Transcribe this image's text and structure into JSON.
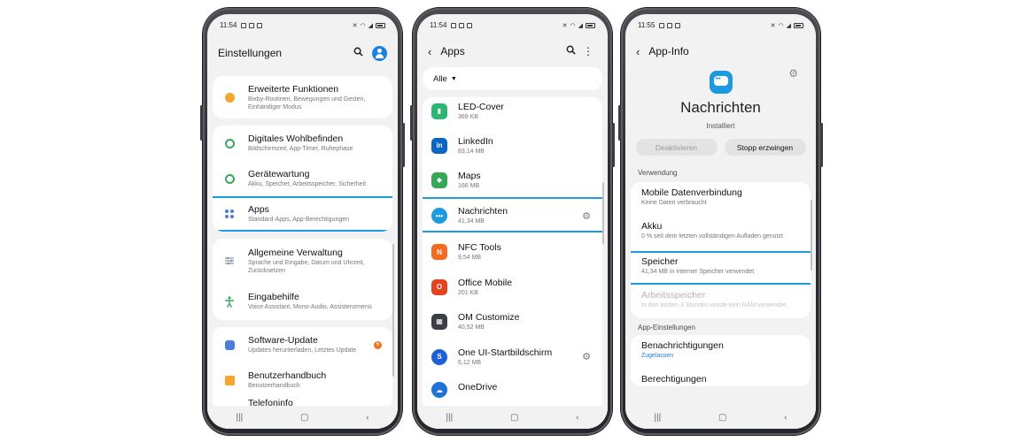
{
  "colors": {
    "accent": "#1e9be0",
    "screen_bg": "#f2f2f2",
    "card_bg": "#ffffff",
    "link": "#1c7fe0",
    "badge": "#f0701e"
  },
  "phone1": {
    "status": {
      "time": "11:54"
    },
    "title": "Einstellungen",
    "icons": {
      "search": "search-icon",
      "account": "avatar-icon"
    },
    "items": [
      {
        "label": "Erweiterte Funktionen",
        "sub": "Bixby-Routinen, Bewegungen und Gesten, Einhändiger Modus",
        "icon_color": "#f4a52a"
      },
      {
        "label": "Digitales Wohlbefinden",
        "sub": "Bildschirmzeit, App-Timer, Ruhephase",
        "icon_color": "#3aa85c"
      },
      {
        "label": "Gerätewartung",
        "sub": "Akku, Speicher, Arbeitsspeicher, Sicherheit",
        "icon_color": "#3aa85c"
      },
      {
        "label": "Apps",
        "sub": "Standard-Apps, App-Berechtigungen",
        "icon_color": "#4a7fd6"
      },
      {
        "label": "Allgemeine Verwaltung",
        "sub": "Sprache und Eingabe, Datum und Uhrzeit, Zurücksetzen",
        "icon_color": "#8a9aa6"
      },
      {
        "label": "Eingabehilfe",
        "sub": "Voice Assistant, Mono-Audio, Assistenzmenü",
        "icon_color": "#3aa85c"
      },
      {
        "label": "Software-Update",
        "sub": "Updates herunterladen, Letztes Update",
        "icon_color": "#4a7fd6",
        "badge": "N"
      },
      {
        "label": "Benutzerhandbuch",
        "sub": "Benutzerhandbuch",
        "icon_color": "#f4a52a"
      },
      {
        "label": "Telefoninfo",
        "sub": ""
      }
    ]
  },
  "phone2": {
    "status": {
      "time": "11:54"
    },
    "title": "Apps",
    "filter": "Alle",
    "apps": [
      {
        "name": "LED-Cover",
        "size": "369 KB",
        "color": "#2bb673",
        "glyph": "▮"
      },
      {
        "name": "LinkedIn",
        "size": "83,14 MB",
        "color": "#0a66c2",
        "glyph": "in"
      },
      {
        "name": "Maps",
        "size": "166 MB",
        "color": "#34a853",
        "glyph": "◆"
      },
      {
        "name": "Nachrichten",
        "size": "41,34 MB",
        "color": "#1e9be0",
        "glyph": "•••",
        "gear": true
      },
      {
        "name": "NFC Tools",
        "size": "9,54 MB",
        "color": "#f26b21",
        "glyph": "N"
      },
      {
        "name": "Office Mobile",
        "size": "201 KB",
        "color": "#e3441c",
        "glyph": "O"
      },
      {
        "name": "OM Customize",
        "size": "40,52 MB",
        "color": "#3b3f45",
        "glyph": "▦"
      },
      {
        "name": "One UI-Startbildschirm",
        "size": "6,12 MB",
        "color": "#1c5fd6",
        "glyph": "S",
        "gear": true
      },
      {
        "name": "OneDrive",
        "size": "",
        "color": "#1e73d6",
        "glyph": "☁"
      }
    ]
  },
  "phone3": {
    "status": {
      "time": "11:55"
    },
    "title": "App-Info",
    "app_name": "Nachrichten",
    "app_state": "Installiert",
    "buttons": {
      "deactivate": "Deaktivieren",
      "force_stop": "Stopp erzwingen"
    },
    "sections": {
      "usage": "Verwendung",
      "app_settings": "App-Einstellungen"
    },
    "usage_items": [
      {
        "label": "Mobile Datenverbindung",
        "sub": "Keine Daten verbraucht"
      },
      {
        "label": "Akku",
        "sub": "0 % seit dem letzten vollständigen Aufladen genutzt"
      },
      {
        "label": "Speicher",
        "sub": "41,34 MB in Interner Speicher verwendet"
      },
      {
        "label": "Arbeitsspeicher",
        "sub": "In den letzten 3 Stunden wurde kein RAM verwendet.",
        "disabled": true
      }
    ],
    "settings_items": [
      {
        "label": "Benachrichtigungen",
        "sub": "Zugelassen"
      },
      {
        "label": "Berechtigungen",
        "sub": ""
      }
    ]
  }
}
